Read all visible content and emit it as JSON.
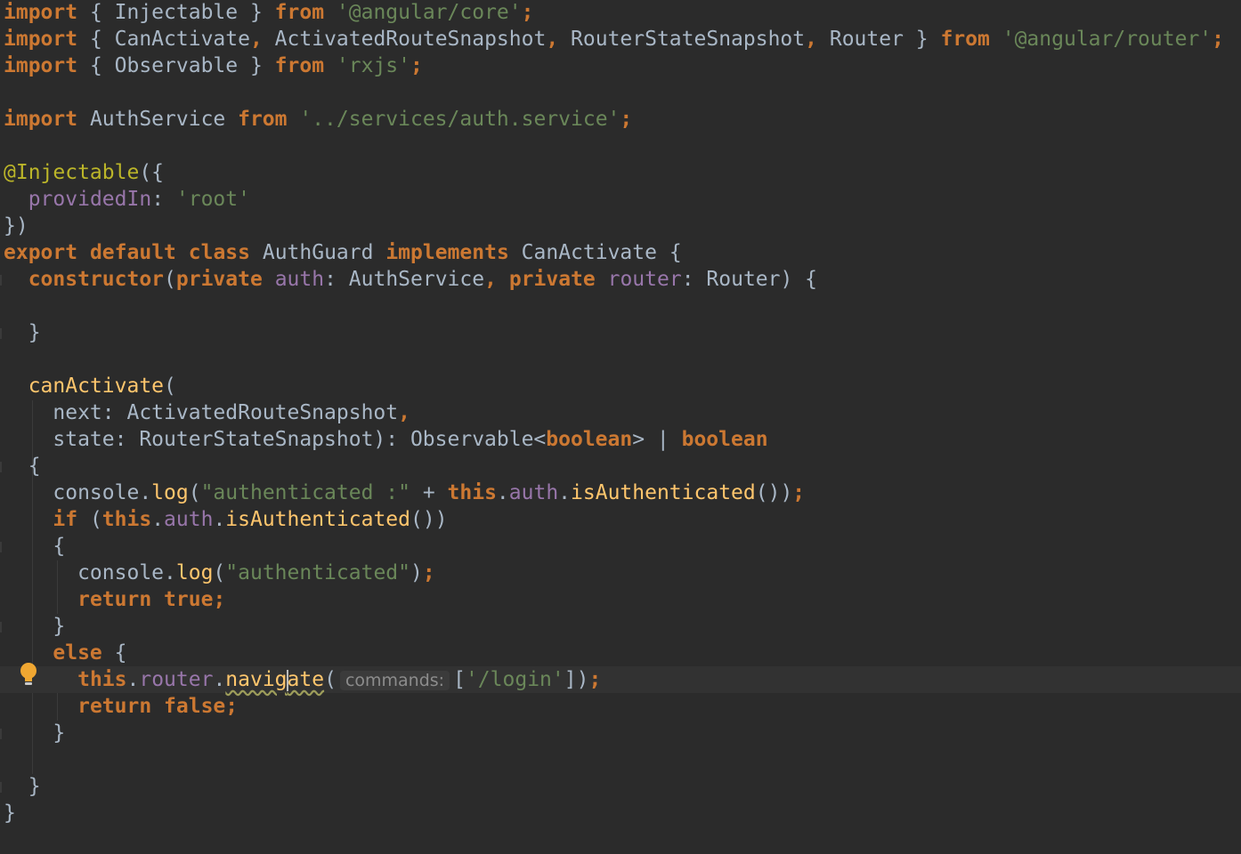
{
  "editor": {
    "language": "TypeScript",
    "lines": [
      "import { Injectable } from '@angular/core';",
      "import { CanActivate, ActivatedRouteSnapshot, RouterStateSnapshot, Router } from '@angular/router';",
      "import { Observable } from 'rxjs';",
      "",
      "import AuthService from '../services/auth.service';",
      "",
      "@Injectable({",
      "  providedIn: 'root'",
      "})",
      "export default class AuthGuard implements CanActivate {",
      "  constructor(private auth: AuthService, private router: Router) {",
      "",
      "  }",
      "",
      "  canActivate(",
      "    next: ActivatedRouteSnapshot,",
      "    state: RouterStateSnapshot): Observable<boolean> | boolean",
      "  {",
      "    console.log(\"authenticated :\" + this.auth.isAuthenticated());",
      "    if (this.auth.isAuthenticated())",
      "    {",
      "      console.log(\"authenticated\");",
      "      return true;",
      "    }",
      "    else {",
      "      this.router.navigate(['/login']);",
      "      return false;",
      "    }",
      "",
      "  }",
      "}"
    ],
    "inlay_hint": "commands:",
    "current_line": 26,
    "gutter_icon": "lightbulb-icon",
    "colors": {
      "background": "#2b2b2b",
      "current_line": "#323232",
      "keyword": "#cc7832",
      "string": "#6a8759",
      "function": "#ffc66d",
      "field": "#9876aa",
      "annotation": "#bbb529",
      "text": "#a9b7c6",
      "hint": "#8c8c8c"
    }
  }
}
